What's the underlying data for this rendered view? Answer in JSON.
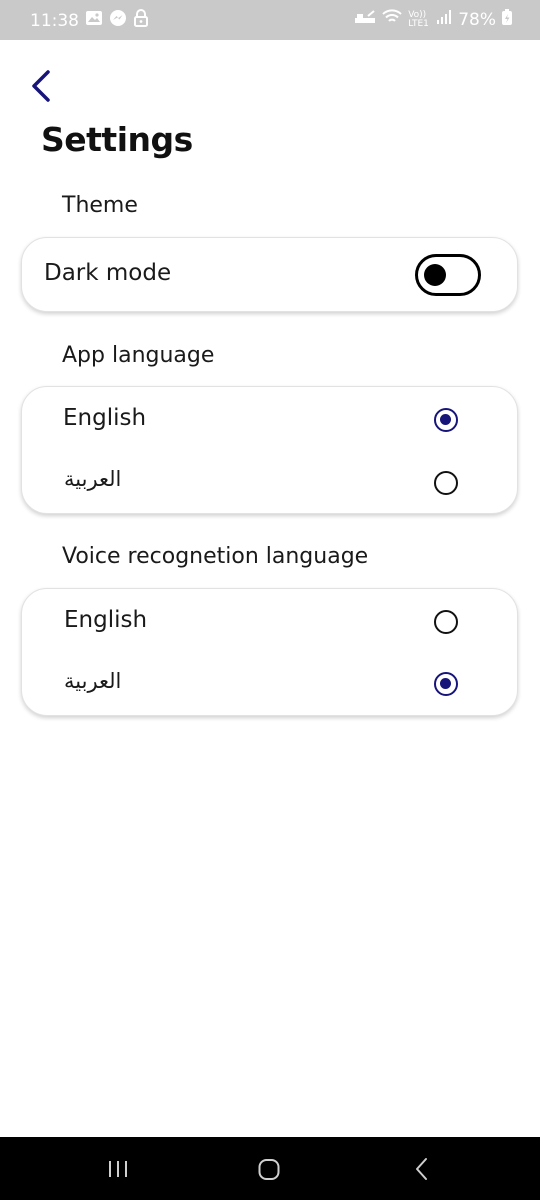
{
  "status_bar": {
    "time": "11:38",
    "battery": "78%",
    "network_label": "Vo)) LTE1",
    "icons": [
      "gallery-icon",
      "messenger-icon",
      "lock-icon",
      "hotspot-icon",
      "wifi-icon",
      "signal-icon",
      "battery-icon"
    ]
  },
  "header": {
    "back_icon": "chevron-left-icon",
    "title": "Settings"
  },
  "theme": {
    "label": "Theme",
    "dark_mode_label": "Dark mode",
    "dark_mode_on": false
  },
  "app_language": {
    "label": "App language",
    "options": [
      {
        "label": "English",
        "selected": true
      },
      {
        "label": "العربية",
        "selected": false
      }
    ]
  },
  "voice_language": {
    "label": "Voice recognetion language",
    "options": [
      {
        "label": "English",
        "selected": false
      },
      {
        "label": "العربية",
        "selected": true
      }
    ]
  },
  "nav_bar": {
    "icons": [
      "recent-apps-icon",
      "home-icon",
      "back-icon"
    ]
  },
  "colors": {
    "accent": "#17147a",
    "status_bar": "#c9c9c9",
    "nav_bar": "#000000"
  }
}
